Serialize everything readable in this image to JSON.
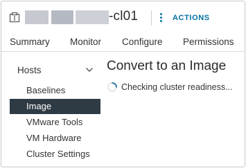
{
  "header": {
    "object_name_suffix": "-cl01",
    "actions_label": "ACTIONS",
    "colors": {
      "accent": "#0072a3",
      "redaction": "#c6c9d0"
    }
  },
  "tabs": [
    {
      "label": "Summary"
    },
    {
      "label": "Monitor"
    },
    {
      "label": "Configure"
    },
    {
      "label": "Permissions"
    }
  ],
  "sidebar": {
    "group_label": "Hosts",
    "items": [
      {
        "label": "Baselines",
        "active": false
      },
      {
        "label": "Image",
        "active": true
      },
      {
        "label": "VMware Tools",
        "active": false
      },
      {
        "label": "VM Hardware",
        "active": false
      },
      {
        "label": "Cluster Settings",
        "active": false
      }
    ],
    "active_color": "#2f3b44"
  },
  "main": {
    "title": "Convert to an Image",
    "status_text": "Checking cluster readiness..."
  },
  "icons": [
    "cluster-icon",
    "kebab-menu-icon",
    "chevron-down-icon",
    "spinner-icon"
  ]
}
